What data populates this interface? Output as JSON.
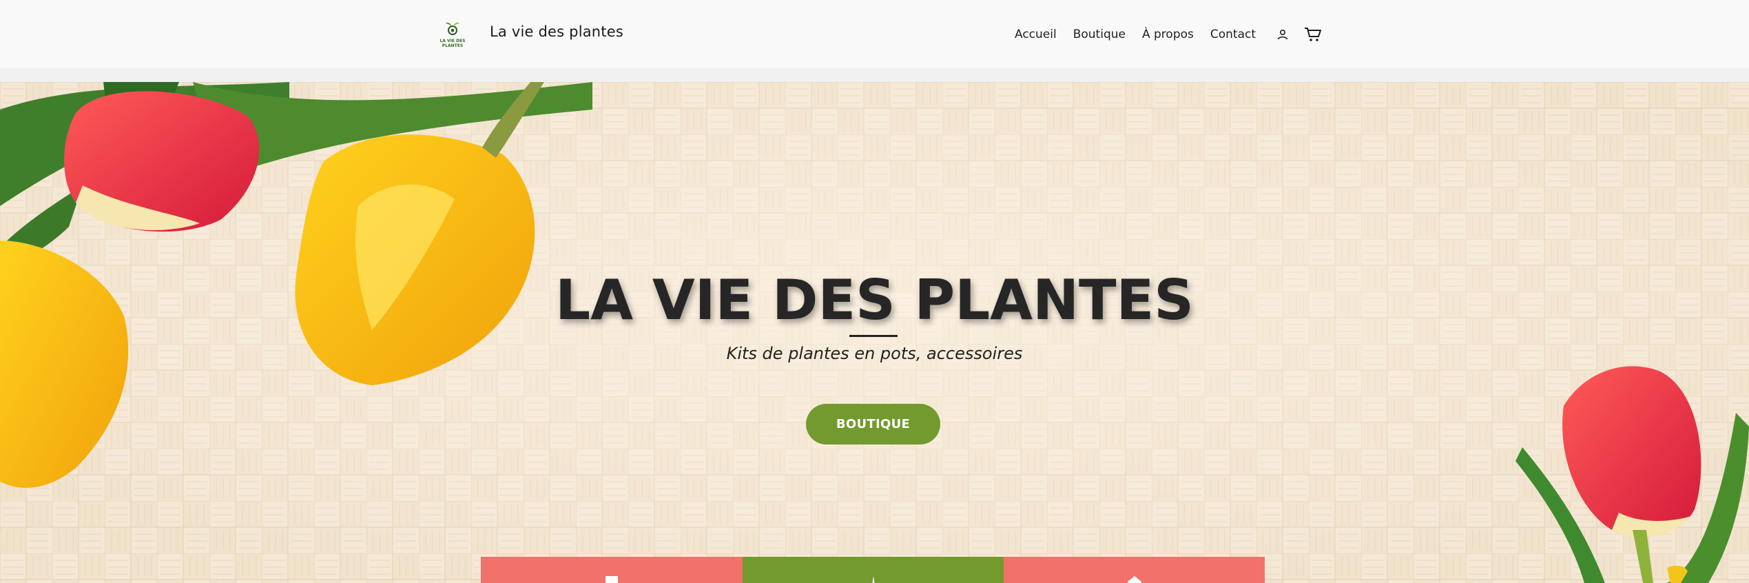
{
  "header": {
    "logo_text": "LA VIE DES PLANTES",
    "site_title": "La vie des plantes",
    "nav": [
      {
        "label": "Accueil"
      },
      {
        "label": "Boutique"
      },
      {
        "label": "À propos"
      },
      {
        "label": "Contact"
      }
    ],
    "icons": [
      "account-icon",
      "cart-icon"
    ]
  },
  "hero": {
    "title": "LA VIE DES PLANTES",
    "subtitle": "Kits de plantes en pots, accessoires",
    "button_label": "BOUTIQUE"
  },
  "features": [
    {
      "icon": "feature-icon-1",
      "color": "#f2716a"
    },
    {
      "icon": "feature-icon-2",
      "color": "#729a2e"
    },
    {
      "icon": "feature-icon-3",
      "color": "#f2716a"
    }
  ],
  "colors": {
    "accent_green": "#729a2e",
    "accent_coral": "#f2716a",
    "header_bg": "#f8f9f8"
  }
}
